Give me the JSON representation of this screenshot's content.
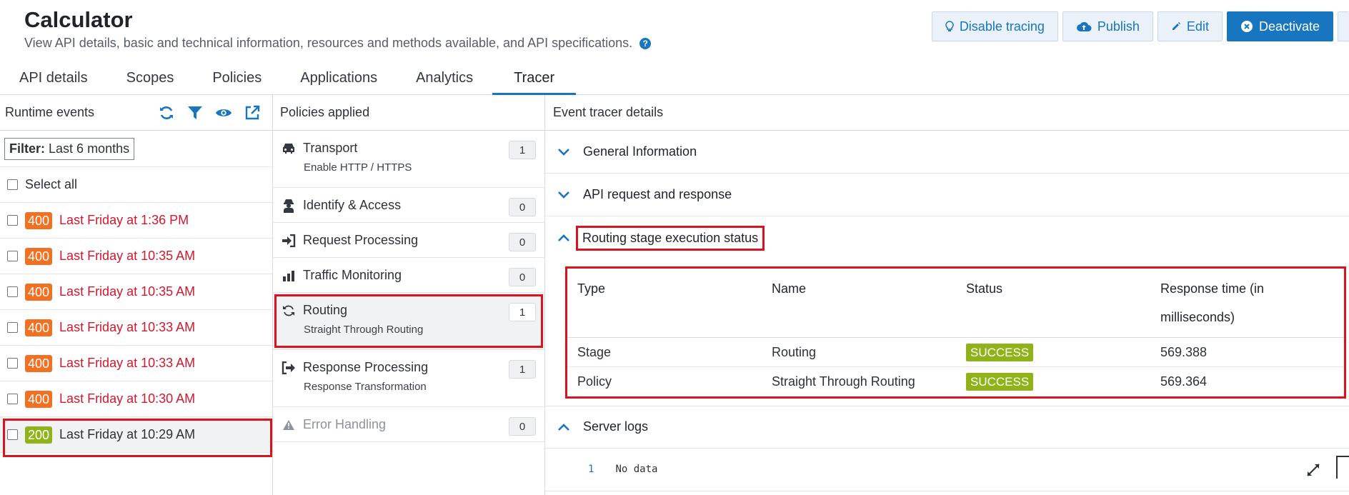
{
  "header": {
    "title": "Calculator",
    "subtitle": "View API details, basic and technical information, resources and methods available, and API specifications.",
    "help_label": "?"
  },
  "toolbar": {
    "disable_tracing": "Disable tracing",
    "publish": "Publish",
    "edit": "Edit",
    "deactivate": "Deactivate"
  },
  "tabs": [
    {
      "label": "API details"
    },
    {
      "label": "Scopes"
    },
    {
      "label": "Policies"
    },
    {
      "label": "Applications"
    },
    {
      "label": "Analytics"
    },
    {
      "label": "Tracer",
      "active": true
    }
  ],
  "runtime": {
    "title": "Runtime events",
    "filter_label": "Filter:",
    "filter_value": "Last 6 months",
    "select_all": "Select all",
    "events": [
      {
        "code": "400",
        "time": "Last Friday at 1:36 PM"
      },
      {
        "code": "400",
        "time": "Last Friday at 10:35 AM"
      },
      {
        "code": "400",
        "time": "Last Friday at 10:35 AM"
      },
      {
        "code": "400",
        "time": "Last Friday at 10:33 AM"
      },
      {
        "code": "400",
        "time": "Last Friday at 10:33 AM"
      },
      {
        "code": "400",
        "time": "Last Friday at 10:30 AM"
      },
      {
        "code": "200",
        "time": "Last Friday at 10:29 AM",
        "selected": true
      }
    ]
  },
  "policies": {
    "title": "Policies applied",
    "items": [
      {
        "name": "Transport",
        "sub": "Enable HTTP / HTTPS",
        "count": "1"
      },
      {
        "name": "Identify & Access",
        "count": "0"
      },
      {
        "name": "Request Processing",
        "count": "0"
      },
      {
        "name": "Traffic Monitoring",
        "count": "0"
      },
      {
        "name": "Routing",
        "sub": "Straight Through Routing",
        "count": "1",
        "active": true
      },
      {
        "name": "Response Processing",
        "sub": "Response Transformation",
        "count": "1"
      },
      {
        "name": "Error Handling",
        "count": "0",
        "disabled": true
      }
    ]
  },
  "details": {
    "title": "Event tracer details",
    "sections": {
      "general": "General Information",
      "request": "API request and response",
      "routing": "Routing stage execution status",
      "logs": "Server logs"
    },
    "table": {
      "headers": [
        "Type",
        "Name",
        "Status",
        "Response time (in milliseconds)"
      ],
      "rows": [
        {
          "type": "Stage",
          "name": "Routing",
          "status": "SUCCESS",
          "time": "569.388"
        },
        {
          "type": "Policy",
          "name": "Straight Through Routing",
          "status": "SUCCESS",
          "time": "569.364"
        }
      ]
    },
    "logs": {
      "line": "1",
      "text": "No data"
    }
  },
  "colors": {
    "accent": "#1776bf",
    "error_badge": "#f27022",
    "ok_badge": "#8fb318",
    "error_text": "#d2182d",
    "highlight": "#d9141f"
  }
}
